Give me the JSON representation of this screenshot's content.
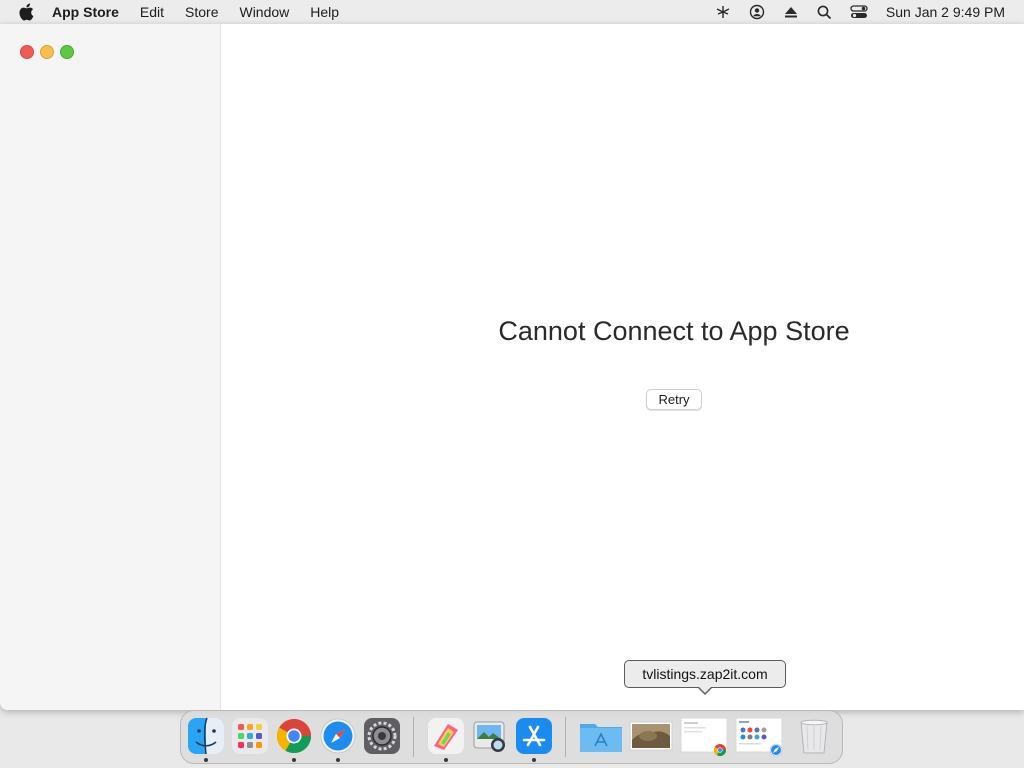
{
  "menubar": {
    "app_name": "App Store",
    "items": [
      "Edit",
      "Store",
      "Window",
      "Help"
    ],
    "clock": "Sun Jan 2  9:49 PM"
  },
  "main": {
    "error_title": "Cannot Connect to App Store",
    "retry_label": "Retry"
  },
  "tooltip": {
    "text": "tvlistings.zap2it.com"
  },
  "dock": {
    "apps": [
      "finder-icon",
      "launchpad-icon",
      "chrome-icon",
      "safari-icon",
      "system-preferences-icon",
      "color-picker-icon",
      "preview-icon",
      "app-store-icon"
    ],
    "stacks": [
      "applications-folder-icon",
      "photo-thumbnail-icon",
      "chrome-window-thumbnail-icon",
      "safari-window-thumbnail-icon",
      "trash-icon"
    ]
  },
  "colors": {
    "close": "#ee5c56",
    "minimize": "#f5be4f",
    "maximize": "#5ec842",
    "accent": "#1a8cf0"
  }
}
